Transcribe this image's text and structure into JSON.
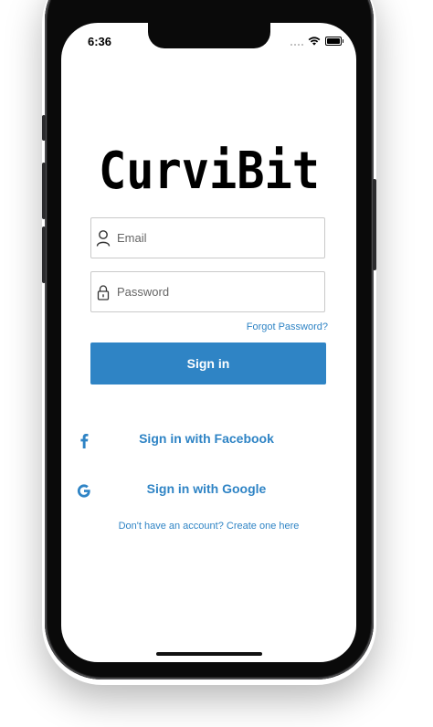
{
  "status_bar": {
    "time": "6:36",
    "icons": [
      "signal-dots-icon",
      "wifi-icon",
      "battery-icon"
    ]
  },
  "logo": {
    "text": "CurviBit"
  },
  "form": {
    "email": {
      "placeholder": "Email",
      "value": "",
      "icon": "user-icon"
    },
    "password": {
      "placeholder": "Password",
      "value": "",
      "icon": "lock-icon"
    },
    "forgot_label": "Forgot Password?",
    "signin_label": "Sign in"
  },
  "social": {
    "facebook_label": "Sign in with Facebook",
    "google_label": "Sign in with Google"
  },
  "footer": {
    "create_account": "Don't have an account? Create one here"
  },
  "colors": {
    "accent": "#2f84c5",
    "field_border": "#c9c9c9",
    "text_dark": "#000000"
  }
}
